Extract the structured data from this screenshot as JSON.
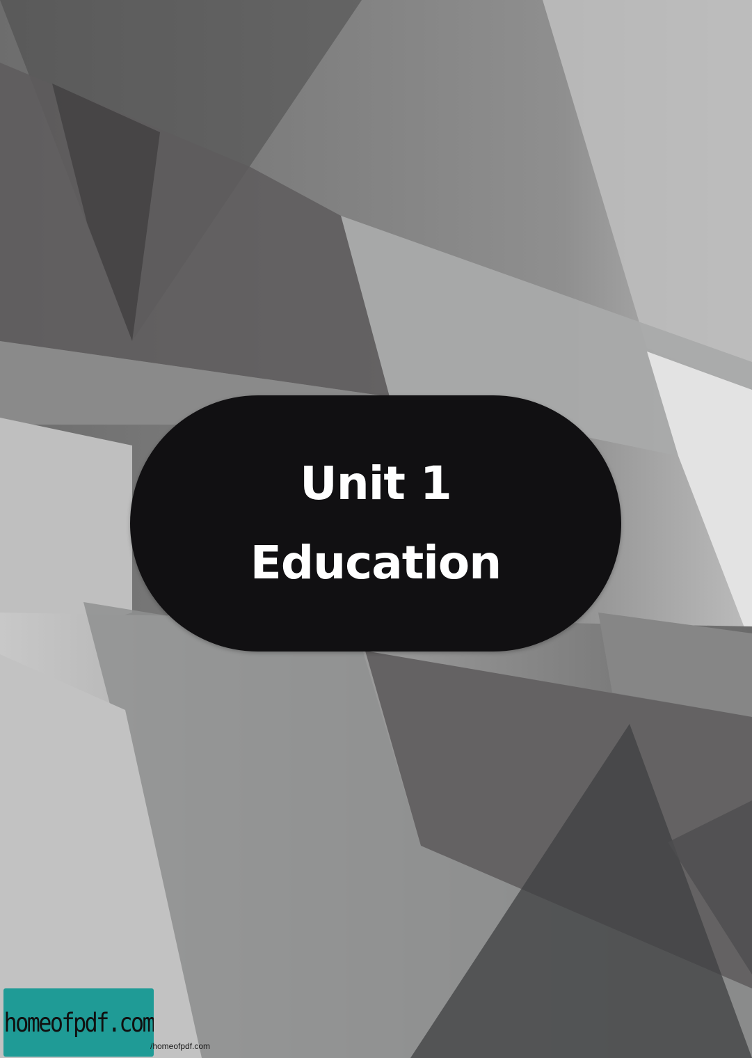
{
  "title": {
    "line1": "Unit 1",
    "line2": "Education"
  },
  "watermark": {
    "logo_text": "homeofpdf.com",
    "url_text": "/homeofpdf.com"
  },
  "colors": {
    "title_box": "#111012",
    "title_text": "#ffffff",
    "logo_badge": "#1f9b96",
    "background_base": "#c5c5c5"
  }
}
